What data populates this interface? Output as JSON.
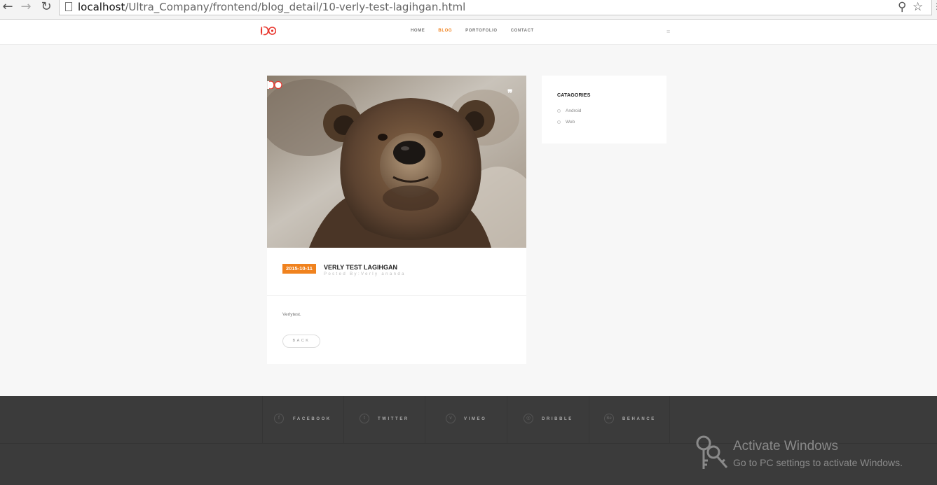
{
  "browser": {
    "url_host": "localhost",
    "url_path": "/Ultra_Company/frontend/blog_detail/10-verly-test-lagihgan.html"
  },
  "header": {
    "nav": [
      {
        "label": "HOME",
        "active": false
      },
      {
        "label": "BLOG",
        "active": true
      },
      {
        "label": "PORTOFOLIO",
        "active": false
      },
      {
        "label": "CONTACT",
        "active": false
      }
    ]
  },
  "post": {
    "date": "2015-10-11",
    "title": "VERLY TEST LAGIHGAN",
    "meta": "Posted By:Verly ananda",
    "body": "Verlytest.",
    "back_label": "BACK"
  },
  "sidebar": {
    "title": "CATAGORIES",
    "categories": [
      "Android",
      "Web"
    ]
  },
  "footer": {
    "socials": [
      {
        "label": "FACEBOOK",
        "icon": "facebook-icon",
        "glyph": "f"
      },
      {
        "label": "TWITTER",
        "icon": "twitter-icon",
        "glyph": "t"
      },
      {
        "label": "VIMEO",
        "icon": "vimeo-icon",
        "glyph": "v"
      },
      {
        "label": "DRIBBLE",
        "icon": "dribbble-icon",
        "glyph": "◎"
      },
      {
        "label": "BEHANCE",
        "icon": "behance-icon",
        "glyph": "Be"
      }
    ]
  },
  "watermark": {
    "title": "Activate Windows",
    "subtitle": "Go to PC settings to activate Windows."
  },
  "colors": {
    "accent": "#f0821e",
    "footer_bg": "#3b3b3b",
    "page_bg": "#f7f7f7"
  }
}
